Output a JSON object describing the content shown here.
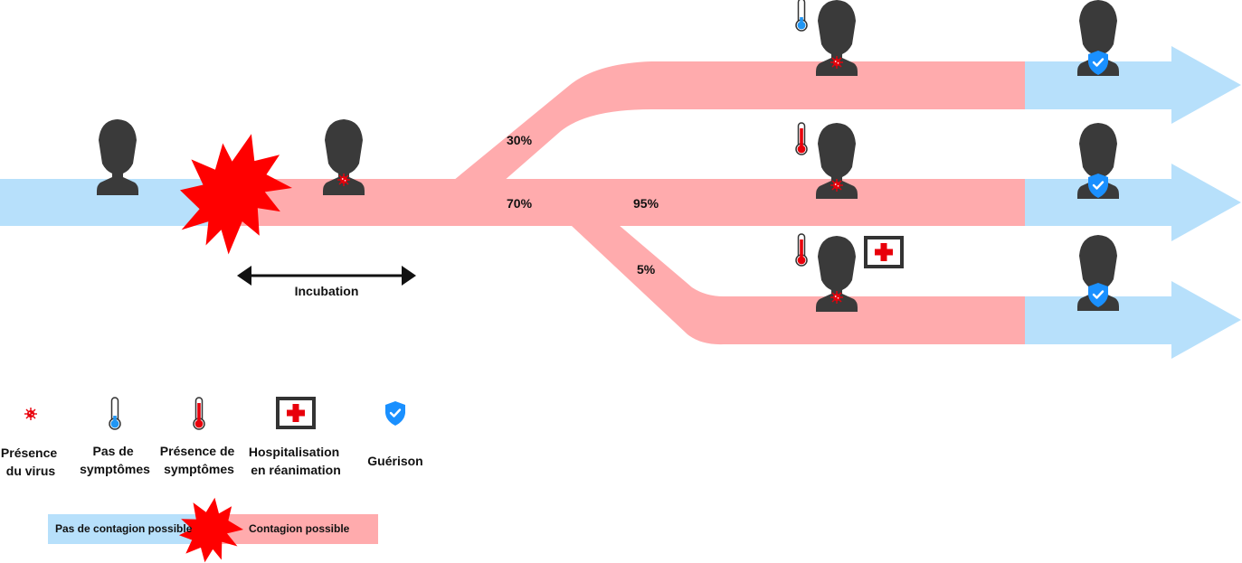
{
  "colors": {
    "no_contagion": "#b7e0fb",
    "contagion": "#ffabad",
    "explosion": "#ff0000",
    "person": "#3a3a3a",
    "virus": "#e8000b",
    "thermo_low": "#2196f3",
    "thermo_high": "#e8000b",
    "shield": "#1a90ff"
  },
  "percentages": {
    "branch_top": "30%",
    "main": "70%",
    "branch_middle": "95%",
    "branch_bottom": "5%"
  },
  "incubation_label": "Incubation",
  "legend": {
    "virus": [
      "Présence",
      "du virus"
    ],
    "no_symptoms": [
      "Pas de",
      "symptômes"
    ],
    "symptoms": [
      "Présence de",
      "symptômes"
    ],
    "icu": [
      "Hospitalisation",
      "en réanimation"
    ],
    "recovery": [
      "Guérison"
    ]
  },
  "contagion_bar": {
    "no_contagion": "Pas de contagion possible",
    "contagion": "Contagion possible"
  }
}
